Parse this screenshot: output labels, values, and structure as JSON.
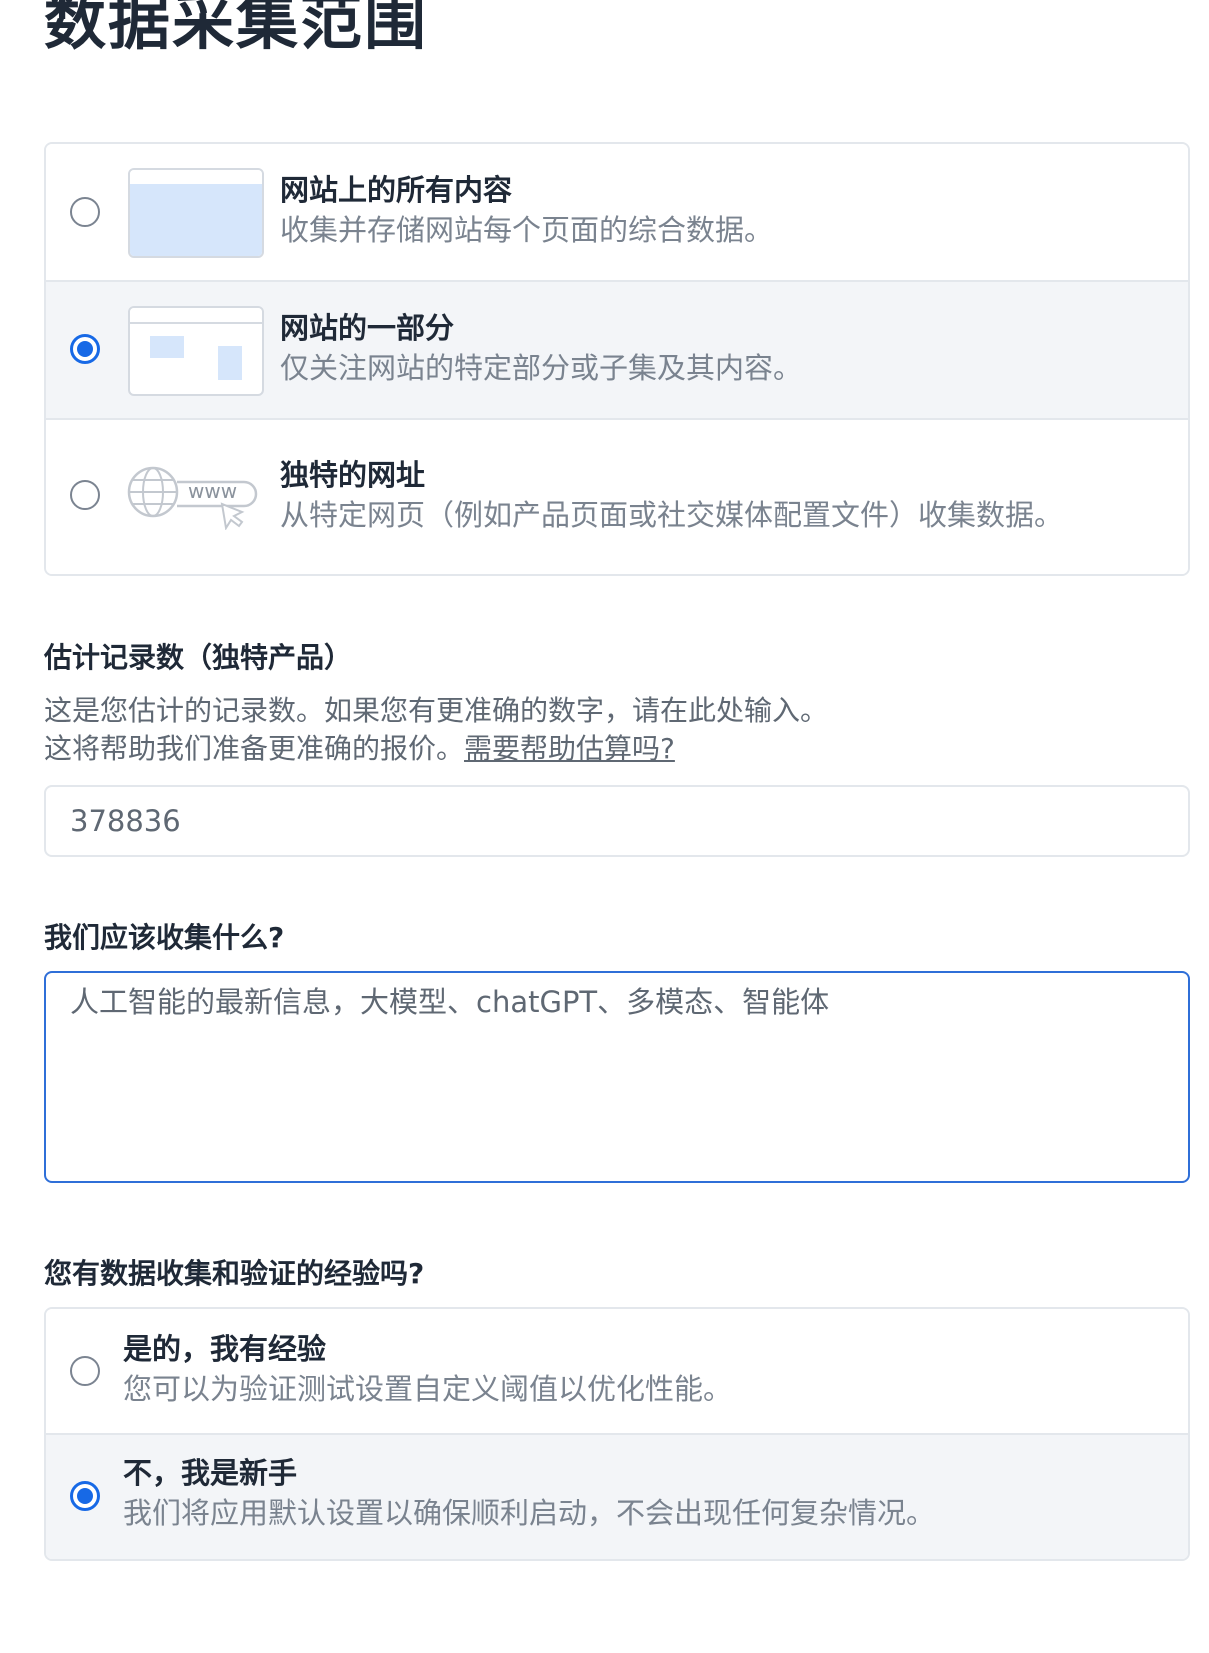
{
  "page": {
    "title": "数据采集范围"
  },
  "scope": {
    "options": [
      {
        "title": "网站上的所有内容",
        "description": "收集并存储网站每个页面的综合数据。",
        "selected": false,
        "icon": "full-page-thumbnail-icon"
      },
      {
        "title": "网站的一部分",
        "description": "仅关注网站的特定部分或子集及其内容。",
        "selected": true,
        "icon": "partial-page-thumbnail-icon"
      },
      {
        "title": "独特的网址",
        "description": "从特定网页（例如产品页面或社交媒体配置文件）收集数据。",
        "selected": false,
        "icon": "www-globe-cursor-icon",
        "icon_text": "www"
      }
    ]
  },
  "records": {
    "label": "估计记录数（独特产品）",
    "help_line1": "这是您估计的记录数。如果您有更准确的数字，请在此处输入。",
    "help_line2": "这将帮助我们准备更准确的报价。",
    "help_link": "需要帮助估算吗?",
    "value": "378836"
  },
  "collect": {
    "label": "我们应该收集什么?",
    "value": "人工智能的最新信息，大模型、chatGPT、多模态、智能体"
  },
  "experience": {
    "label": "您有数据收集和验证的经验吗?",
    "options": [
      {
        "title": "是的，我有经验",
        "description": "您可以为验证测试设置自定义阈值以优化性能。",
        "selected": false
      },
      {
        "title": "不，我是新手",
        "description": "我们将应用默认设置以确保顺利启动，不会出现任何复杂情况。",
        "selected": true
      }
    ]
  },
  "colors": {
    "accent": "#1769e6",
    "selected_bg": "#f3f5f8",
    "border": "#e3e7ec",
    "thumb_fill": "#d6e6fb"
  }
}
